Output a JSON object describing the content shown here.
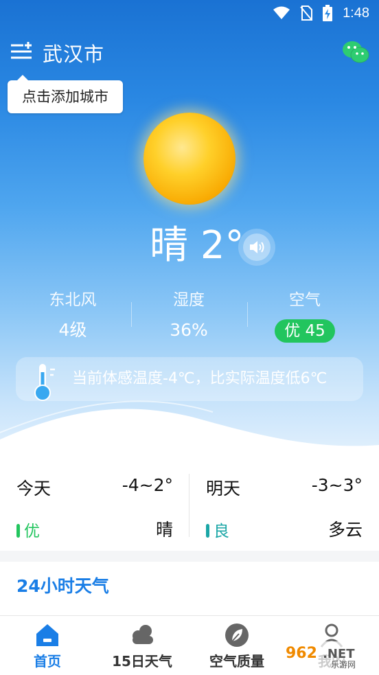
{
  "status_bar": {
    "time": "1:48"
  },
  "header": {
    "city": "武汉市"
  },
  "tooltip": {
    "text": "点击添加城市"
  },
  "current": {
    "condition": "晴",
    "temperature": "2°"
  },
  "stats": {
    "wind_label": "东北风",
    "wind_value": "4级",
    "humidity_label": "湿度",
    "humidity_value": "36%",
    "air_label": "空气",
    "air_value": "优 45"
  },
  "feels_like": {
    "text": "当前体感温度-4℃，比实际温度低6℃"
  },
  "forecast": {
    "today": {
      "day": "今天",
      "temp": "-4~2°",
      "aqi": "优",
      "condition": "晴"
    },
    "tomorrow": {
      "day": "明天",
      "temp": "-3~3°",
      "aqi": "良",
      "condition": "多云"
    }
  },
  "section_24h": {
    "title": "24小时天气"
  },
  "nav": {
    "items": [
      {
        "label": "首页",
        "icon": "home-icon"
      },
      {
        "label": "15日天气",
        "icon": "cloud-icon"
      },
      {
        "label": "空气质量",
        "icon": "leaf-icon"
      },
      {
        "label": "我的",
        "icon": "user-icon"
      }
    ]
  },
  "watermark": {
    "text": "962.NET",
    "sub": "乐游网"
  },
  "colors": {
    "accent": "#1a7ee6",
    "aqi_good": "#22c55e",
    "aqi_moderate": "#1aa6a6",
    "wechat": "#2ecc71"
  }
}
